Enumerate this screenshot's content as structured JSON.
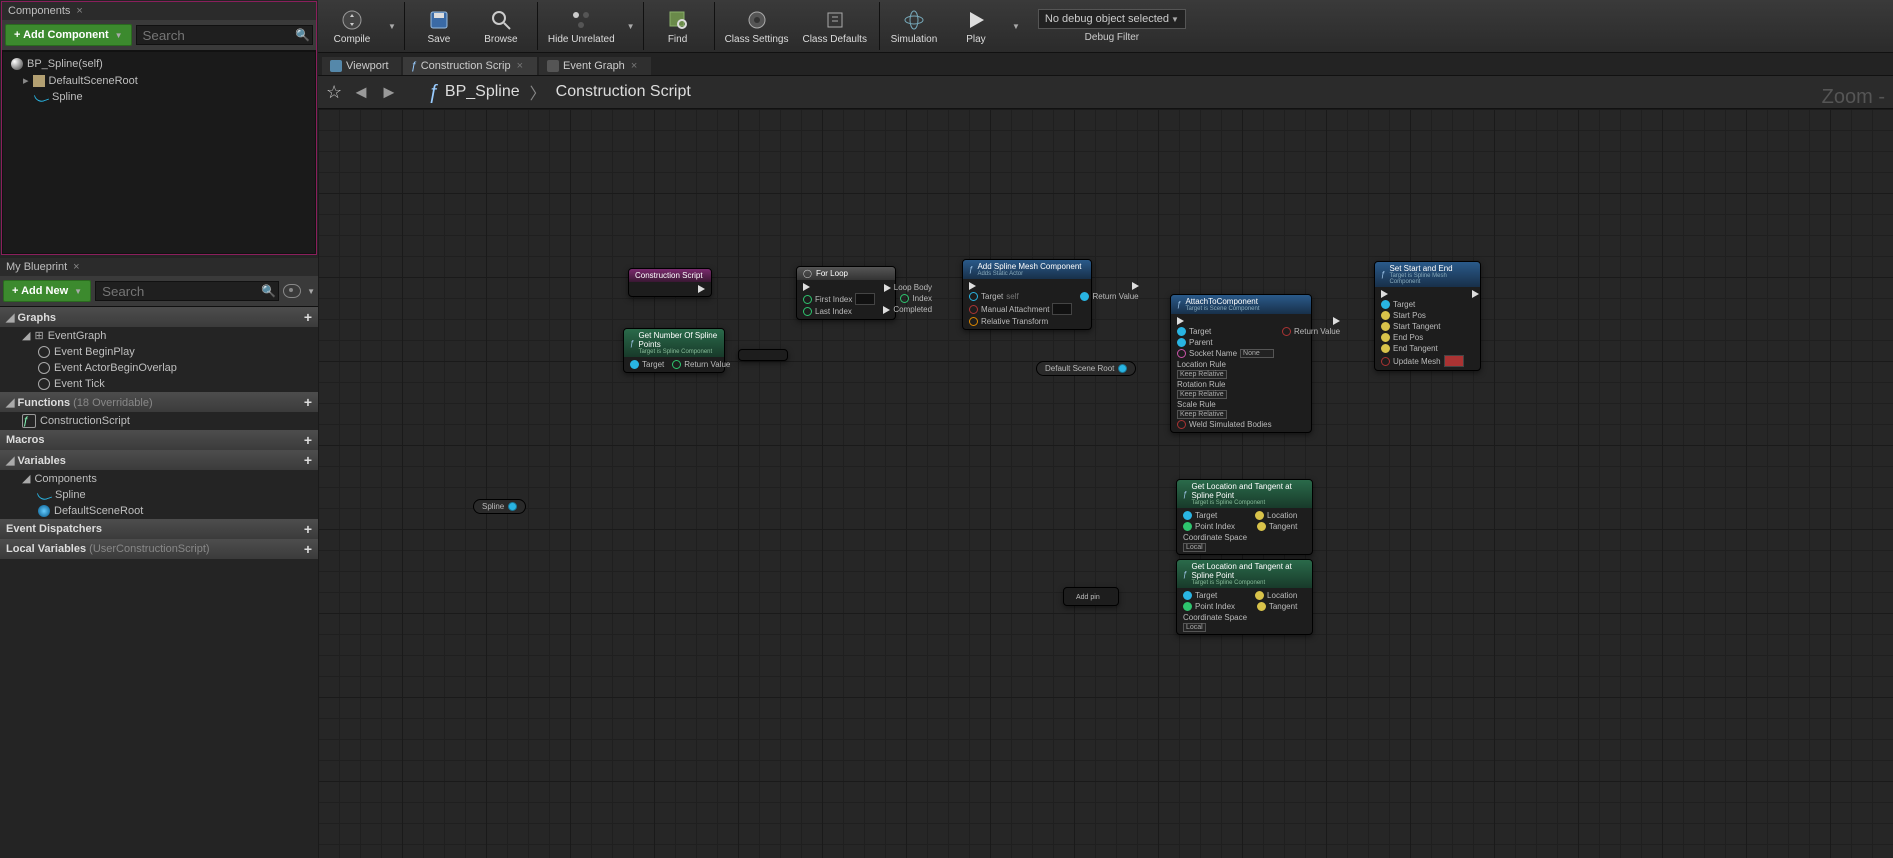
{
  "components_tab": "Components",
  "add_component": "+ Add Component",
  "comp_search": "Search",
  "comp_tree": {
    "root": "BP_Spline(self)",
    "child1": "DefaultSceneRoot",
    "child2": "Spline"
  },
  "myblueprint_tab": "My Blueprint",
  "add_new": "+ Add New",
  "mb_search": "Search",
  "sections": {
    "graphs": "Graphs",
    "eventgraph": "EventGraph",
    "evt1": "Event BeginPlay",
    "evt2": "Event ActorBeginOverlap",
    "evt3": "Event Tick",
    "functions": "Functions",
    "functions_sub": "(18 Overridable)",
    "construction": "ConstructionScript",
    "macros": "Macros",
    "variables": "Variables",
    "var_components": "Components",
    "var_spline": "Spline",
    "var_dsr": "DefaultSceneRoot",
    "dispatchers": "Event Dispatchers",
    "localvars": "Local Variables",
    "localvars_sub": "(UserConstructionScript)"
  },
  "toolbar": {
    "compile": "Compile",
    "save": "Save",
    "browse": "Browse",
    "hide": "Hide Unrelated",
    "find": "Find",
    "classsettings": "Class Settings",
    "classdefaults": "Class Defaults",
    "simulate": "Simulation",
    "play": "Play",
    "debug_sel": "No debug object selected",
    "debug_filter": "Debug Filter"
  },
  "tabs": {
    "viewport": "Viewport",
    "construction": "Construction Scrip",
    "eventgraph": "Event Graph"
  },
  "breadcrumb": {
    "bp": "BP_Spline",
    "cs": "Construction Script"
  },
  "zoom": "Zoom -",
  "nodes": {
    "cs": "Construction Script",
    "forloop": "For Loop",
    "forloop_pins": {
      "first": "First Index",
      "last": "Last Index",
      "body": "Loop Body",
      "index": "Index",
      "completed": "Completed"
    },
    "getnum": "Get Number Of Spline Points",
    "getnum_sub": "Target is Spline Component",
    "target": "Target",
    "return": "Return Value",
    "spline_var": "Spline",
    "dsr_var": "Default Scene Root",
    "addmesh": "Add Spline Mesh Component",
    "addmesh_sub": "Adds Static Actor",
    "addmesh_pins": {
      "target": "Target",
      "self": "self",
      "manual": "Manual Attachment",
      "rel": "Relative Transform",
      "rv": "Return Value"
    },
    "attach": "AttachToComponent",
    "attach_sub": "Target is Scene Component",
    "attach_pins": {
      "target": "Target",
      "parent": "Parent",
      "socket": "Socket Name",
      "socketval": "None",
      "locrule": "Location Rule",
      "keeprel": "Keep Relative",
      "rotrule": "Rotation Rule",
      "scalerule": "Scale Rule",
      "weld": "Weld Simulated Bodies",
      "rv": "Return Value"
    },
    "setstart": "Set Start and End",
    "setstart_sub": "Target is Spline Mesh Component",
    "setstart_pins": {
      "target": "Target",
      "startpos": "Start Pos",
      "starttan": "Start Tangent",
      "endpos": "End Pos",
      "endtan": "End Tangent",
      "update": "Update Mesh"
    },
    "getloctitle": "Get Location and Tangent at Spline Point",
    "getloc_sub": "Target is Spline Component",
    "getloc_pins": {
      "target": "Target",
      "point": "Point Index",
      "coord": "Coordinate Space",
      "local": "Local",
      "location": "Location",
      "tangent": "Tangent"
    },
    "addnode": {
      "addpin": "Add pin"
    }
  }
}
